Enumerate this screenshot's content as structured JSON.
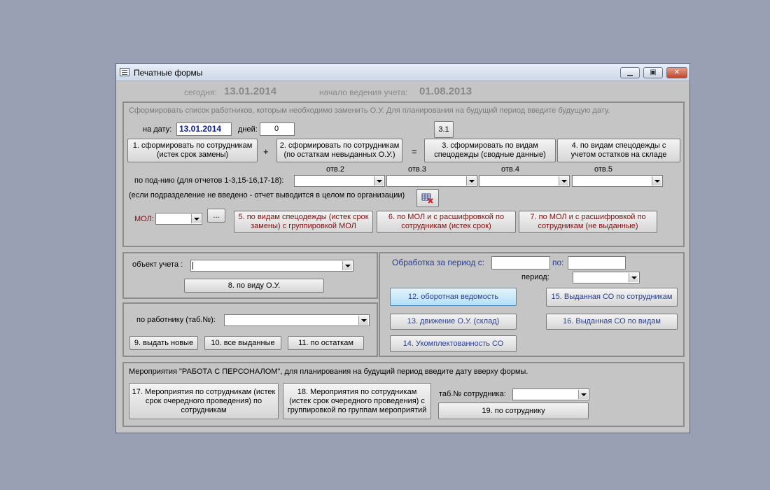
{
  "window": {
    "title": "Печатные формы",
    "controls": {
      "minimize": "▁",
      "maximize": "▣",
      "close": "✕"
    }
  },
  "header": {
    "today_label": "сегодня:",
    "today_value": "13.01.2014",
    "start_label": "начало ведения учета:",
    "start_value": "01.08.2013"
  },
  "top_section": {
    "instructions": "Сформировать список работников, которым необходимо заменить О.У. Для планирования на будущий период введите будущую дату.",
    "date_label": "на дату:",
    "date_value": "13.01.2014",
    "days_label": "дней:",
    "days_value": "0",
    "btn_3_1": "3.1",
    "btn1": "1. сформировать по сотрудникам (истек срок замены)",
    "plus": "+",
    "btn2": "2. сформировать по сотрудникам (по остаткам невыданных О.У.)",
    "equals": "=",
    "btn3": "3. сформировать по видам спецодежды (сводные данные)",
    "btn4": "4.  по видам спецодежды с учетом остатков на складе",
    "dept_label": "по под-нию (для отчетов 1-3,15-16,17-18):",
    "otv_labels": [
      "отв.2",
      "отв.3",
      "отв.4",
      "отв.5"
    ],
    "dept_note": "(если подразделение не введено -  отчет выводится в целом по организации)",
    "mol_label": "МОЛ:",
    "ellipsis": "...",
    "btn5": "5. по видам спецодежды (истек срок замены) с группировкой МОЛ",
    "btn6": "6. по МОЛ и с расшифровкой по сотрудникам (истек срок)",
    "btn7": "7. по МОЛ и с расшифровкой по сотрудникам (не выданные)"
  },
  "object_section": {
    "label": "объект учета :",
    "value": "",
    "btn8": "8. по виду О.У."
  },
  "worker_section": {
    "label": "по работнику (таб.№):",
    "btn9": "9. выдать новые",
    "btn10": "10. все выданные",
    "btn11": "11. по остаткам"
  },
  "period_section": {
    "label": "Обработка за период с:",
    "from_value": "",
    "to_label": "по:",
    "to_value": "",
    "period_label": "период:",
    "btn12": "12. оборотная ведомость",
    "btn13": "13. движение О.У. (склад)",
    "btn14": "14. Укомплектованность СО",
    "btn15": "15. Выданная СО по сотрудникам",
    "btn16": "16. Выданная СО по видам"
  },
  "events_section": {
    "title": "Мероприятия \"РАБОТА С ПЕРСОНАЛОМ\", для планирования на будущий период введите дату вверху формы.",
    "btn17": "17. Мероприятия по сотрудникам (истек срок очередного проведения) по сотрудникам",
    "btn18": "18. Мероприятия по сотрудникам (истек срок очередного проведения) с группировкой по группам мероприятий",
    "tab_label": "таб.№ сотрудника:",
    "btn19": "19. по сотруднику"
  },
  "colors": {
    "desktop": "#9aa0b4",
    "window_bg": "#c5c5c5",
    "date_text": "#0a1a9c",
    "red_button_text": "#7b1010",
    "blue_button_text": "#2a3e8c",
    "header_text": "#8a8a8a"
  }
}
